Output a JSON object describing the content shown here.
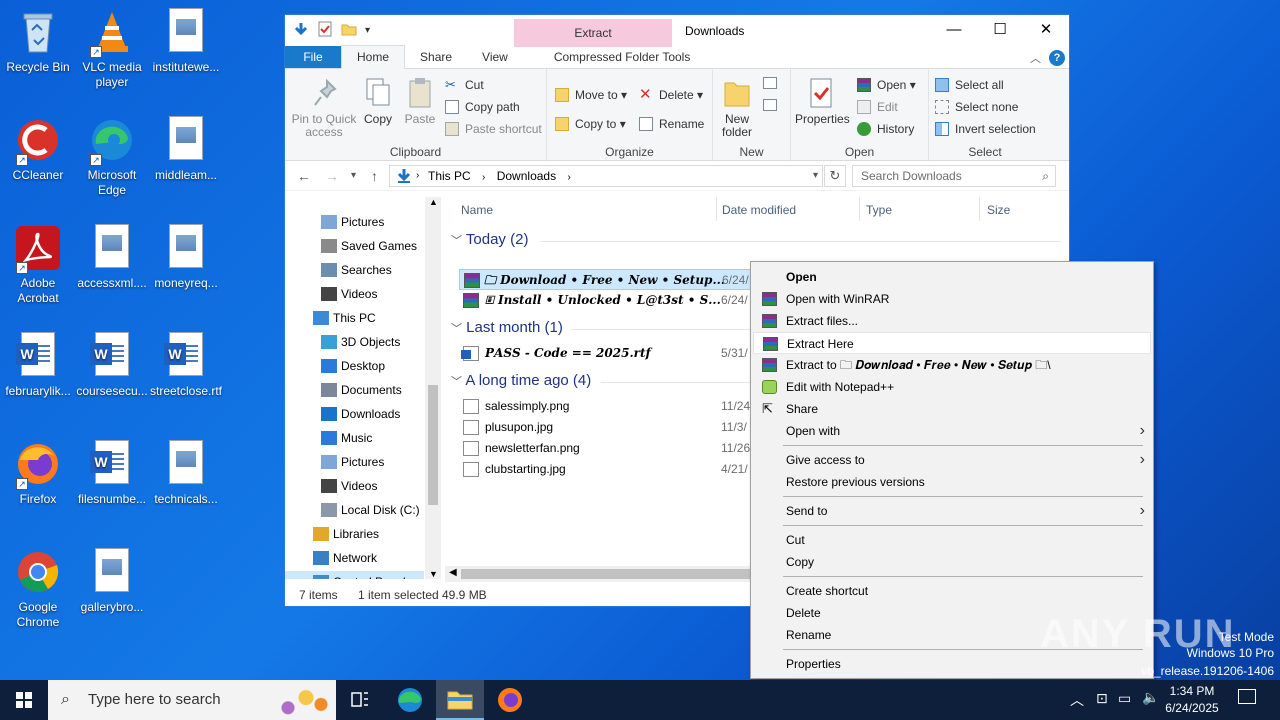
{
  "desktop": {
    "icons": [
      {
        "label": "Recycle Bin"
      },
      {
        "label": "VLC media player"
      },
      {
        "label": "institutewe..."
      },
      {
        "label": "CCleaner"
      },
      {
        "label": "Microsoft Edge"
      },
      {
        "label": "middleam..."
      },
      {
        "label": "Adobe Acrobat"
      },
      {
        "label": "accessxml...."
      },
      {
        "label": "moneyreq..."
      },
      {
        "label": "februarylik..."
      },
      {
        "label": "coursesecu..."
      },
      {
        "label": "streetclose.rtf"
      },
      {
        "label": "Firefox"
      },
      {
        "label": "filesnumbe..."
      },
      {
        "label": "technicals..."
      },
      {
        "label": "Google Chrome"
      },
      {
        "label": "gallerybro..."
      }
    ]
  },
  "explorer": {
    "title": "Downloads",
    "context_tab": "Extract",
    "tabs": {
      "file": "File",
      "home": "Home",
      "share": "Share",
      "view": "View",
      "compressed": "Compressed Folder Tools"
    },
    "ribbon": {
      "clipboard": {
        "label": "Clipboard",
        "pin": "Pin to Quick access",
        "copy": "Copy",
        "paste": "Paste",
        "cut": "Cut",
        "copy_path": "Copy path",
        "paste_shortcut": "Paste shortcut"
      },
      "organize": {
        "label": "Organize",
        "move_to": "Move to",
        "copy_to": "Copy to",
        "delete": "Delete",
        "rename": "Rename"
      },
      "new": {
        "label": "New",
        "new_folder": "New folder"
      },
      "open": {
        "label": "Open",
        "properties": "Properties",
        "open": "Open",
        "edit": "Edit",
        "history": "History"
      },
      "select": {
        "label": "Select",
        "select_all": "Select all",
        "select_none": "Select none",
        "invert": "Invert selection"
      }
    },
    "address": {
      "this_pc": "This PC",
      "downloads": "Downloads",
      "search_placeholder": "Search Downloads"
    },
    "nav": [
      "Pictures",
      "Saved Games",
      "Searches",
      "Videos",
      "This PC",
      "3D Objects",
      "Desktop",
      "Documents",
      "Downloads",
      "Music",
      "Pictures",
      "Videos",
      "Local Disk (C:)",
      "Libraries",
      "Network",
      "Control Panel"
    ],
    "columns": {
      "name": "Name",
      "date": "Date modified",
      "type": "Type",
      "size": "Size"
    },
    "groups": {
      "today": "Today (2)",
      "last_month": "Last month (1)",
      "long_ago": "A long time ago (4)"
    },
    "files": {
      "today": [
        {
          "name": "🗀 𝑫𝒐𝒘𝒏𝒍𝒐𝒂𝒅 • 𝑭𝒓𝒆𝒆 • 𝑵𝒆𝒘 • 𝑺𝒆𝒕𝒖𝒑...",
          "date": "6/24/"
        },
        {
          "name": "🗉 𝑰𝒏𝒔𝒕𝒂𝒍𝒍 • 𝑼𝒏𝒍𝒐𝒄𝒌𝒆𝒅 • 𝑳@𝒕3𝒔𝒕 • 𝑺...",
          "date": "6/24/"
        }
      ],
      "last_month": [
        {
          "name": "𝑷𝑨𝑺𝑺 - 𝑪𝒐𝒅𝒆 == 2025.rtf",
          "date": "5/31/"
        }
      ],
      "long_ago": [
        {
          "name": "salessimply.png",
          "date": "11/24"
        },
        {
          "name": "plusupon.jpg",
          "date": "11/3/"
        },
        {
          "name": "newsletterfan.png",
          "date": "11/26"
        },
        {
          "name": "clubstarting.jpg",
          "date": "4/21/"
        }
      ]
    },
    "status": {
      "items": "7 items",
      "selected": "1 item selected",
      "size": "49.9 MB"
    }
  },
  "context_menu": {
    "items": [
      "Open",
      "Open with WinRAR",
      "Extract files...",
      "Extract Here",
      "Extract to 🗀 𝑫𝒐𝒘𝒏𝒍𝒐𝒂𝒅 • 𝑭𝒓𝒆𝒆 • 𝑵𝒆𝒘 • 𝑺𝒆𝒕𝒖𝒑 🗀\\",
      "Edit with Notepad++",
      "Share",
      "Open with",
      "Give access to",
      "Restore previous versions",
      "Send to",
      "Cut",
      "Copy",
      "Create shortcut",
      "Delete",
      "Rename",
      "Properties"
    ]
  },
  "taskbar": {
    "search_placeholder": "Type here to search",
    "time": "1:34 PM",
    "date": "6/24/2025"
  },
  "watermark": {
    "brand": "ANY RUN",
    "line1": "Test Mode",
    "line2": "Windows 10 Pro",
    "line3": "vb_release.191206-1406"
  },
  "colors": {
    "accent": "#1979ca",
    "selection": "#cce8ff",
    "context_tab": "#f7c9dd"
  }
}
